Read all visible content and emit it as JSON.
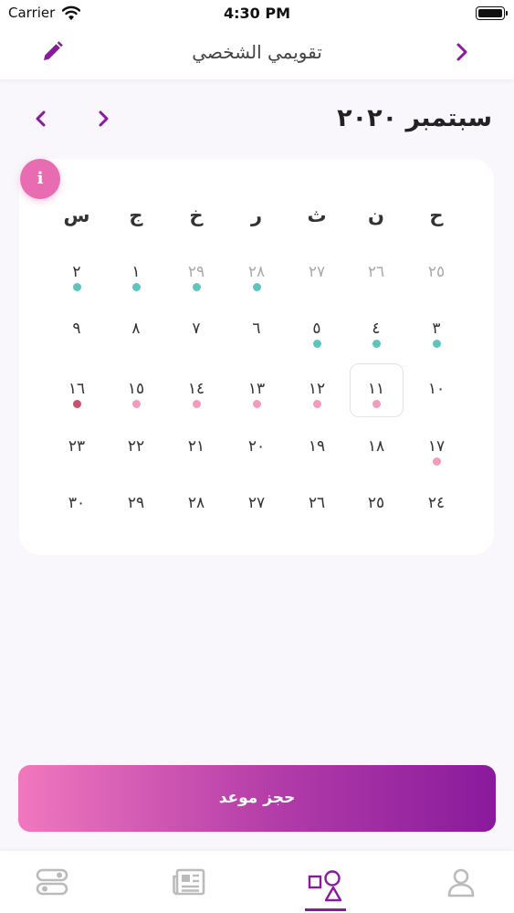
{
  "status_bar": {
    "carrier": "Carrier",
    "time": "4:30 PM"
  },
  "header": {
    "title": "تقويمي الشخصي",
    "edit_icon": "pencil-icon",
    "back_icon": "chevron-right-icon"
  },
  "calendar": {
    "month_label": "سبتمبر ٢٠٢٠",
    "weekdays": [
      "س",
      "ج",
      "خ",
      "ر",
      "ث",
      "ن",
      "ح"
    ],
    "weeks": [
      [
        "٢",
        "١",
        "٢٩",
        "٢٨",
        "٢٧",
        "٢٦",
        "٢٥"
      ],
      [
        "٩",
        "٨",
        "٧",
        "٦",
        "٥",
        "٤",
        "٣"
      ],
      [
        "١٦",
        "١٥",
        "١٤",
        "١٣",
        "١٢",
        "١١",
        "١٠"
      ],
      [
        "٢٣",
        "٢٢",
        "٢١",
        "٢٠",
        "١٩",
        "١٨",
        "١٧"
      ],
      [
        "٣٠",
        "٢٩",
        "٢٨",
        "٢٧",
        "٢٦",
        "٢٥",
        "٢٤"
      ]
    ],
    "muted": [
      [
        0,
        2
      ],
      [
        0,
        3
      ],
      [
        0,
        4
      ],
      [
        0,
        5
      ],
      [
        0,
        6
      ]
    ],
    "dots": [
      {
        "week": 0,
        "col": 0,
        "color": "#5ec5bd"
      },
      {
        "week": 0,
        "col": 1,
        "color": "#5ec5bd"
      },
      {
        "week": 0,
        "col": 2,
        "color": "#5ec5bd"
      },
      {
        "week": 0,
        "col": 3,
        "color": "#5ec5bd"
      },
      {
        "week": 1,
        "col": 4,
        "color": "#5ec5bd"
      },
      {
        "week": 1,
        "col": 5,
        "color": "#5ec5bd"
      },
      {
        "week": 1,
        "col": 6,
        "color": "#5ec5bd"
      },
      {
        "week": 2,
        "col": 0,
        "color": "#c9506e"
      },
      {
        "week": 2,
        "col": 1,
        "color": "#f29bbd"
      },
      {
        "week": 2,
        "col": 2,
        "color": "#f29bbd"
      },
      {
        "week": 2,
        "col": 3,
        "color": "#f29bbd"
      },
      {
        "week": 2,
        "col": 4,
        "color": "#f29bbd"
      },
      {
        "week": 2,
        "col": 5,
        "color": "#f29bbd"
      },
      {
        "week": 3,
        "col": 6,
        "color": "#f29bbd"
      }
    ],
    "selected": {
      "week": 2,
      "col": 5
    }
  },
  "actions": {
    "book_label": "حجز موعد"
  },
  "tabbar": {
    "items": [
      {
        "icon": "toggles-icon"
      },
      {
        "icon": "newspaper-icon"
      },
      {
        "icon": "shapes-icon",
        "active": true
      },
      {
        "icon": "user-icon"
      }
    ]
  },
  "colors": {
    "accent": "#8a1a9c",
    "pink": "#e86cb2",
    "teal": "#5ec5bd"
  }
}
